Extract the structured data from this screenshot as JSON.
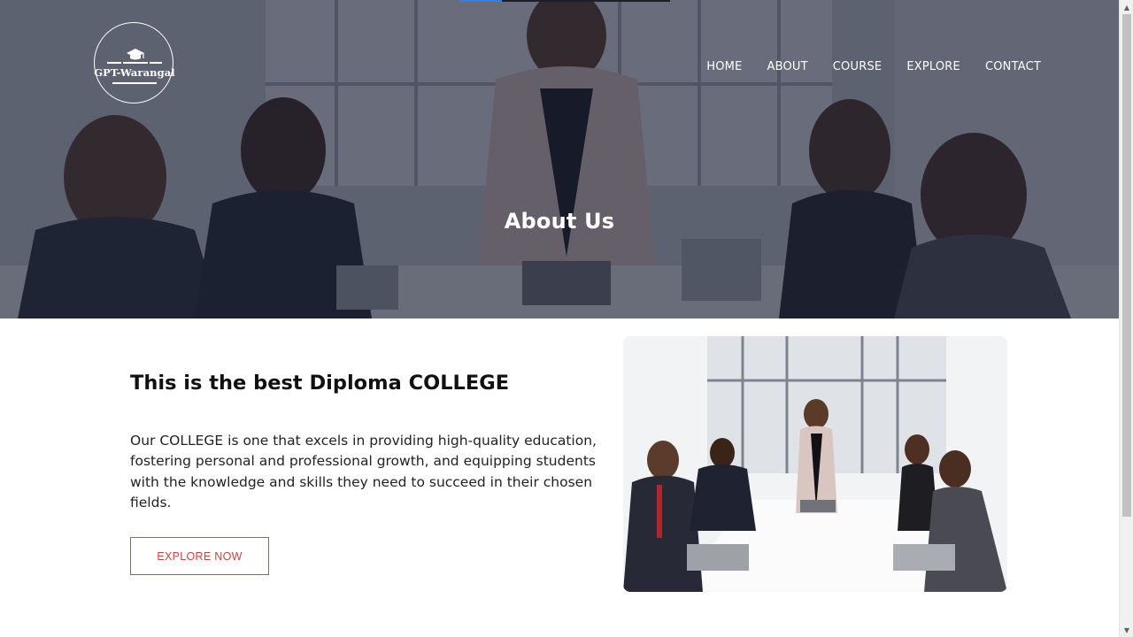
{
  "brand": {
    "logo_text": "GPT-Warangal"
  },
  "nav": {
    "items": [
      {
        "label": "HOME"
      },
      {
        "label": "ABOUT"
      },
      {
        "label": "COURSE"
      },
      {
        "label": "EXPLORE"
      },
      {
        "label": "CONTACT"
      }
    ]
  },
  "hero": {
    "title": "About Us"
  },
  "about": {
    "heading": "This is the best Diploma COLLEGE",
    "body": "Our COLLEGE is one that excels in providing high-quality education, fostering personal and professional growth, and equipping students with the knowledge and skills they need to succeed in their chosen fields.",
    "button_label": "EXPLORE NOW"
  },
  "colors": {
    "hero_overlay": "#1c2034",
    "button_accent": "#d0403f",
    "top_accent": "#2f80ed"
  },
  "icons": {
    "logo": "graduation-cap-icon",
    "scroll_up": "triangle-up",
    "scroll_down": "triangle-down"
  }
}
